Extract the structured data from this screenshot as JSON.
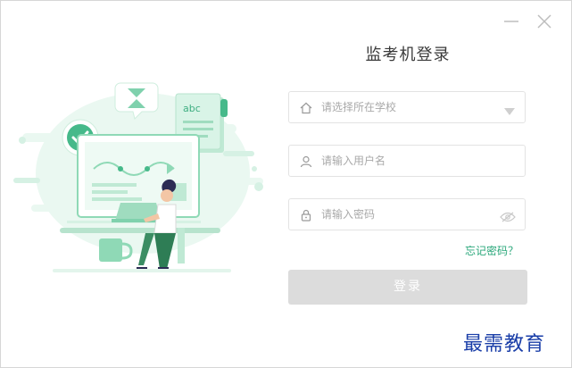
{
  "window": {
    "title": "监考机登录",
    "controls": [
      "minimize-icon",
      "close-icon"
    ]
  },
  "form": {
    "school": {
      "placeholder": "请选择所在学校",
      "icon": "home-icon"
    },
    "username": {
      "placeholder": "请输入用户名",
      "icon": "user-icon"
    },
    "password": {
      "placeholder": "请输入密码",
      "icon": "lock-icon",
      "toggle_icon": "eye-icon"
    },
    "forgot_label": "忘记密码？",
    "login_label": "登录"
  },
  "illustration": {
    "note_text": "abc"
  },
  "watermark": "最需教育",
  "colors": {
    "accent": "#2aa77a",
    "illustration_green": "#8fd9b6",
    "button_disabled": "#dcdcdc",
    "watermark": "#1a3ea8"
  }
}
